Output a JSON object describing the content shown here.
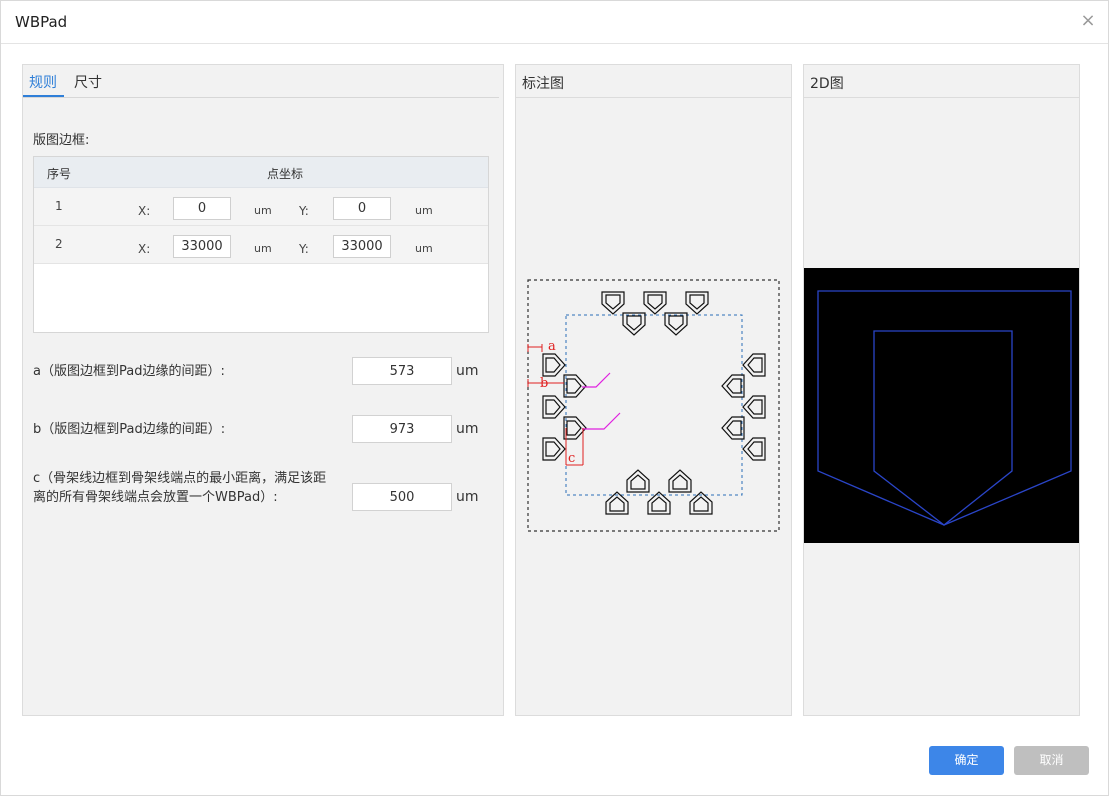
{
  "window": {
    "title": "WBPad",
    "close_glyph": "×"
  },
  "tabs": {
    "rules": "规则",
    "size": "尺寸"
  },
  "left": {
    "border_label": "版图边框:",
    "table": {
      "col_index": "序号",
      "col_coord": "点坐标",
      "rows": [
        {
          "index": "1",
          "x_label": "X:",
          "x_value": "0",
          "x_unit": "um",
          "y_label": "Y:",
          "y_value": "0",
          "y_unit": "um"
        },
        {
          "index": "2",
          "x_label": "X:",
          "x_value": "33000",
          "x_unit": "um",
          "y_label": "Y:",
          "y_value": "33000",
          "y_unit": "um"
        }
      ]
    },
    "params": [
      {
        "label": "a（版图边框到Pad边缘的间距）:",
        "value": "573",
        "unit": "um"
      },
      {
        "label": "b（版图边框到Pad边缘的间距）:",
        "value": "973",
        "unit": "um"
      },
      {
        "label_line1": "c（骨架线边框到骨架线端点的最小距离，满足该距",
        "label_line2": "离的所有骨架线端点会放置一个WBPad）:",
        "value": "500",
        "unit": "um"
      }
    ]
  },
  "middle": {
    "title": "标注图",
    "annotations": {
      "a": "a",
      "b": "b",
      "c": "c"
    }
  },
  "right": {
    "title": "2D图"
  },
  "buttons": {
    "ok": "确定",
    "cancel": "取消"
  },
  "colors": {
    "accent": "#2f7fd8",
    "ok_button": "#3d86e8",
    "cancel_button": "#bfbfbf",
    "pad_outline": "#2a45c8",
    "annotation_red": "#e02020",
    "skeleton_magenta": "#e020e0",
    "inner_border_blue": "#2a6fb8"
  },
  "icons": {
    "close": "close-icon"
  }
}
